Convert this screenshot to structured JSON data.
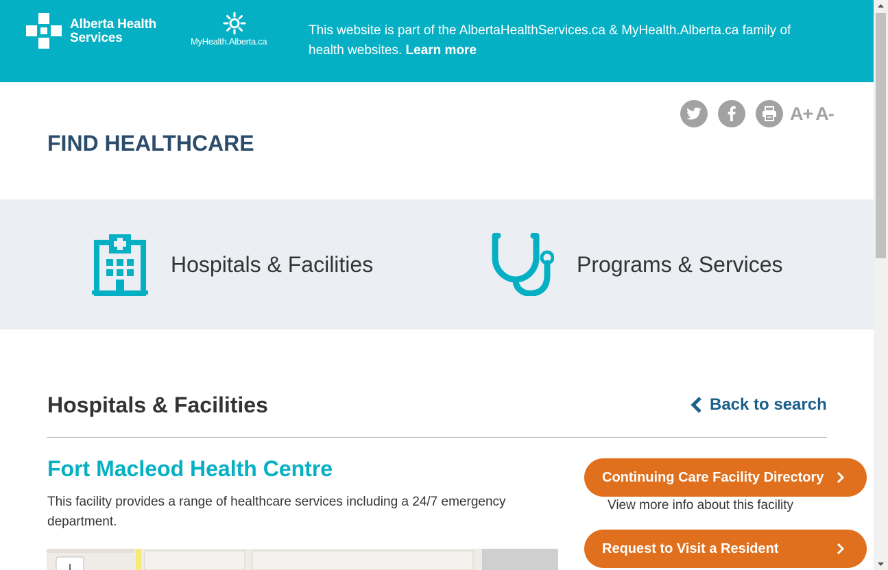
{
  "banner": {
    "ahs_logo_line1": "Alberta Health",
    "ahs_logo_line2": "Services",
    "myhealth_logo": "MyHealth.Alberta.ca",
    "message": "This website is part of the AlbertaHealthServices.ca & MyHealth.Alberta.ca family of health websites.",
    "learn_more": "Learn more",
    "color": "#05b0c4"
  },
  "header": {
    "title": "FIND HEALTHCARE",
    "font_increase": "A+",
    "font_decrease": "A-",
    "icons": [
      "twitter-icon",
      "facebook-icon",
      "print-icon"
    ]
  },
  "nav": {
    "items": [
      {
        "label": "Hospitals & Facilities",
        "icon": "hospital-icon"
      },
      {
        "label": "Programs & Services",
        "icon": "stethoscope-icon"
      }
    ],
    "accent": "#05b0c4"
  },
  "section": {
    "title": "Hospitals & Facilities",
    "back_label": "Back to search"
  },
  "facility": {
    "name": "Fort Macleod Health Centre",
    "description": "This facility provides a range of healthcare services including a 24/7 emergency department.",
    "cta_primary": "Continuing Care Facility Directory",
    "cta_primary_sub": "View more info about this facility",
    "cta_secondary": "Request to Visit a Resident",
    "cta_color": "#e0701d"
  },
  "map": {
    "zoom_in": "+"
  }
}
